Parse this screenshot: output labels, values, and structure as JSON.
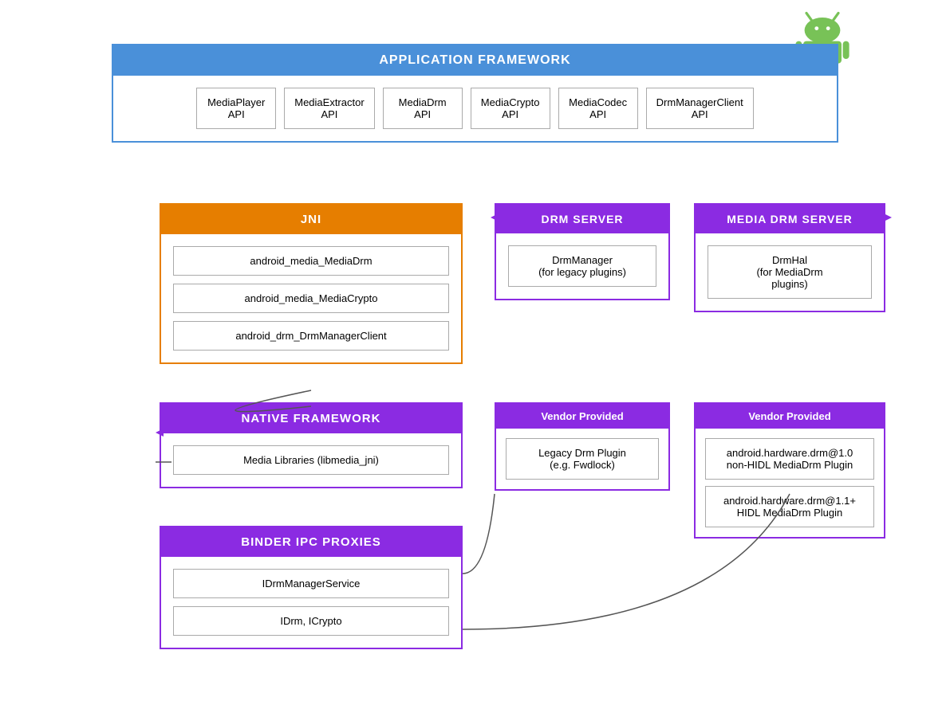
{
  "android_logo": {
    "alt": "Android Logo"
  },
  "app_framework": {
    "header": "APPLICATION FRAMEWORK",
    "apis": [
      {
        "label": "MediaPlayer\nAPI"
      },
      {
        "label": "MediaExtractor\nAPI"
      },
      {
        "label": "MediaDrm\nAPI"
      },
      {
        "label": "MediaCrypto\nAPI"
      },
      {
        "label": "MediaCodec\nAPI"
      },
      {
        "label": "DrmManagerClient\nAPI"
      }
    ]
  },
  "jni": {
    "header": "JNI",
    "items": [
      "android_media_MediaDrm",
      "android_media_MediaCrypto",
      "android_drm_DrmManagerClient"
    ]
  },
  "native_framework": {
    "header": "NATIVE FRAMEWORK",
    "items": [
      "Media Libraries (libmedia_jni)"
    ]
  },
  "binder_ipc": {
    "header": "BINDER IPC PROXIES",
    "items": [
      "IDrmManagerService",
      "IDrm, ICrypto"
    ]
  },
  "drm_server": {
    "header": "DRM SERVER",
    "items": [
      "DrmManager\n(for legacy plugins)"
    ]
  },
  "media_drm_server": {
    "header": "MEDIA DRM SERVER",
    "items": [
      "DrmHal\n(for MediaDrm\nplugins)"
    ]
  },
  "vendor_1": {
    "header": "Vendor Provided",
    "items": [
      "Legacy Drm Plugin\n(e.g. Fwdlock)"
    ]
  },
  "vendor_2": {
    "header": "Vendor Provided",
    "items": [
      "android.hardware.drm@1.0\nnon-HIDL MediaDrm Plugin",
      "android.hardware.drm@1.1+\nHIDL MediaDrm Plugin"
    ]
  }
}
